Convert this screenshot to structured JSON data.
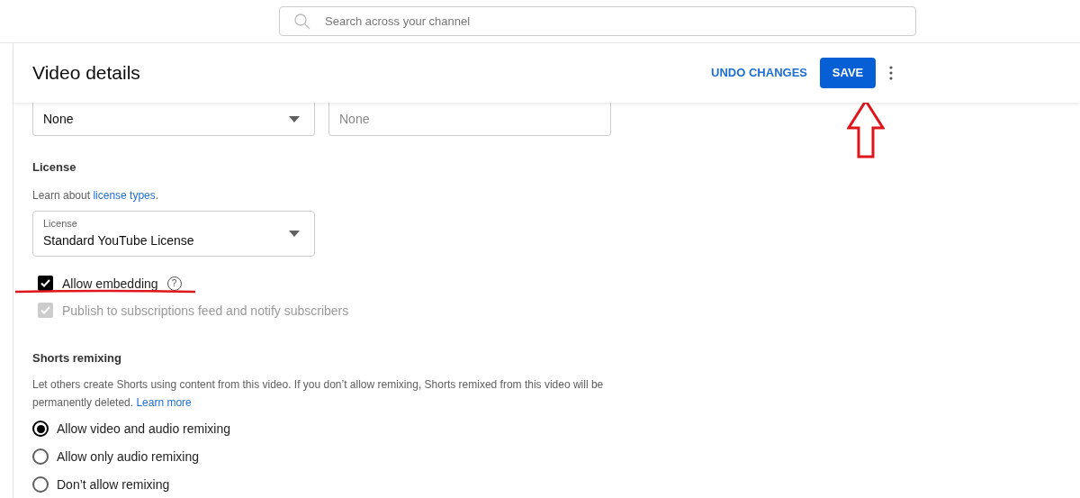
{
  "search": {
    "placeholder": "Search across your channel"
  },
  "header": {
    "title": "Video details",
    "undo": "UNDO CHANGES",
    "save": "SAVE"
  },
  "fields": [
    {
      "value": "None",
      "kind": "dropdown"
    },
    {
      "value": "None",
      "kind": "text"
    }
  ],
  "license": {
    "title": "License",
    "learn_prefix": "Learn about",
    "learn_link": "license types",
    "learn_suffix": ".",
    "select_label": "License",
    "select_value": "Standard YouTube License"
  },
  "checkboxes": [
    {
      "label": "Allow embedding",
      "checked": true,
      "disabled": false,
      "help_icon": "?"
    },
    {
      "label": "Publish to subscriptions feed and notify subscribers",
      "checked": true,
      "disabled": true
    }
  ],
  "remixing": {
    "title": "Shorts remixing",
    "description": "Let others create Shorts using content from this video. If you don’t allow remixing, Shorts remixed from this video will be permanently deleted.",
    "link": "Learn more",
    "options": [
      {
        "label": "Allow video and audio remixing",
        "selected": true
      },
      {
        "label": "Allow only audio remixing",
        "selected": false
      },
      {
        "label": "Don’t allow remixing",
        "selected": false
      }
    ]
  }
}
